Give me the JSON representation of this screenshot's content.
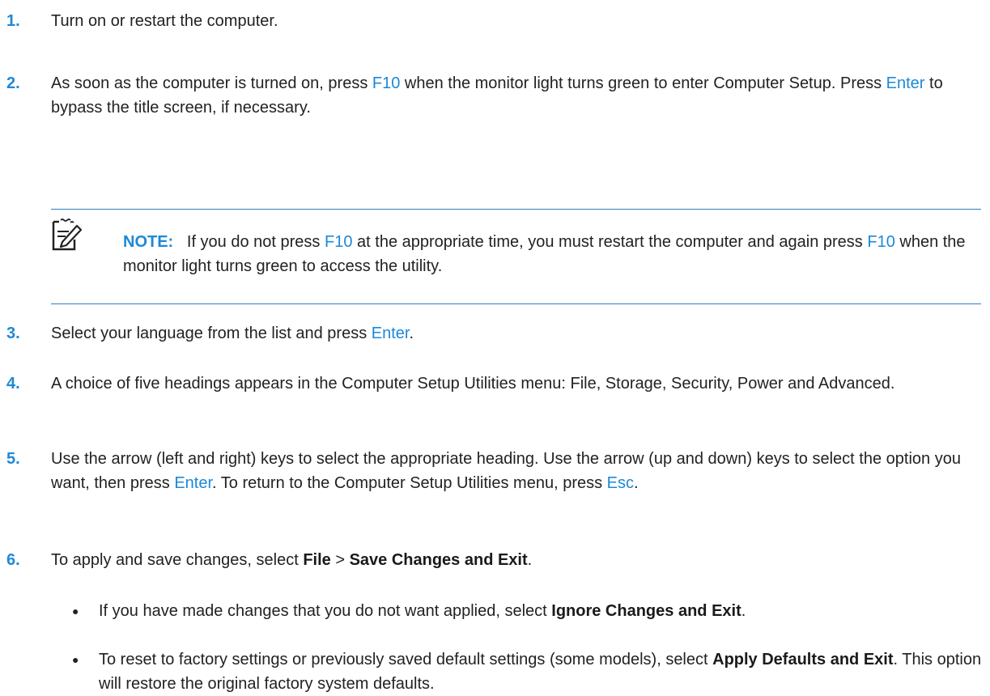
{
  "steps": [
    {
      "num": "1.",
      "text": "Turn on or restart the computer."
    },
    {
      "num": "2.",
      "p1": "As soon as the computer is turned on, press ",
      "k1": "F10",
      "p2": " when the monitor light turns green to enter Computer Setup. Press ",
      "k2": "Enter",
      "p3": " to bypass the title screen, if necessary."
    },
    {
      "num": "3.",
      "p1": "Select your language from the list and press ",
      "k1": "Enter",
      "p2": "."
    },
    {
      "num": "4.",
      "text": "A choice of five headings appears in the Computer Setup Utilities menu: File, Storage, Security, Power and Advanced."
    },
    {
      "num": "5.",
      "p1": "Use the arrow (left and right) keys to select the appropriate heading. Use the arrow (up and down) keys to select the option you want, then press ",
      "k1": "Enter",
      "p2": ". To return to the Computer Setup Utilities menu, press ",
      "k2": "Esc",
      "p3": "."
    },
    {
      "num": "6.",
      "p1": "To apply and save changes, select ",
      "b1": "File",
      "p2": " > ",
      "b2": "Save Changes and Exit",
      "p3": "."
    }
  ],
  "note": {
    "label": "NOTE:",
    "p1": "   If you do not press ",
    "k1": "F10",
    "p2": " at the appropriate time, you must restart the computer and again press ",
    "k2": "F10",
    "p3": " when the monitor light turns green to access the utility."
  },
  "bullets": [
    {
      "symbol": "●",
      "p1": "If you have made changes that you do not want applied, select ",
      "b1": "Ignore Changes and Exit",
      "p2": "."
    },
    {
      "symbol": "●",
      "p1": "To reset to factory settings or previously saved default settings (some models), select ",
      "b1": "Apply Defaults and Exit",
      "p2": ". This option will restore the original factory system defaults."
    }
  ],
  "colors": {
    "accent": "#1e88d7",
    "rule": "#2d7fc9"
  },
  "icons": {
    "note": "note-pencil-icon"
  }
}
